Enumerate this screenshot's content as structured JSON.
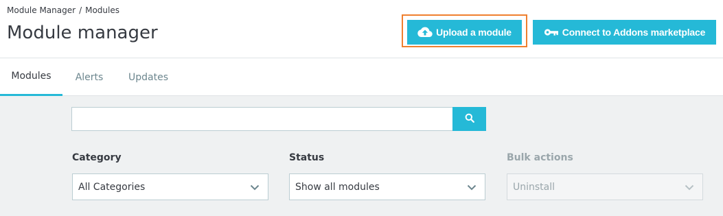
{
  "header": {
    "breadcrumb": [
      {
        "label": "Module Manager"
      },
      {
        "label": "Modules"
      }
    ],
    "breadcrumb_separator": "/",
    "title": "Module manager",
    "buttons": {
      "upload_label": "Upload a module",
      "upload_icon": "cloud-upload-icon",
      "connect_label": "Connect to Addons marketplace",
      "connect_icon": "key-icon"
    }
  },
  "tabs": [
    {
      "label": "Modules",
      "active": true
    },
    {
      "label": "Alerts",
      "active": false
    },
    {
      "label": "Updates",
      "active": false
    }
  ],
  "search": {
    "value": "",
    "placeholder": "",
    "button_icon": "search-icon"
  },
  "filters": {
    "category": {
      "label": "Category",
      "selected": "All Categories"
    },
    "status": {
      "label": "Status",
      "selected": "Show all modules"
    },
    "bulk_actions": {
      "label": "Bulk actions",
      "selected": "Uninstall",
      "disabled": true
    }
  },
  "colors": {
    "accent": "#25b9d7",
    "focus_ring": "#ef7f2e",
    "text": "#363a41",
    "muted": "#6c868e",
    "content_bg": "#eff1f2"
  }
}
